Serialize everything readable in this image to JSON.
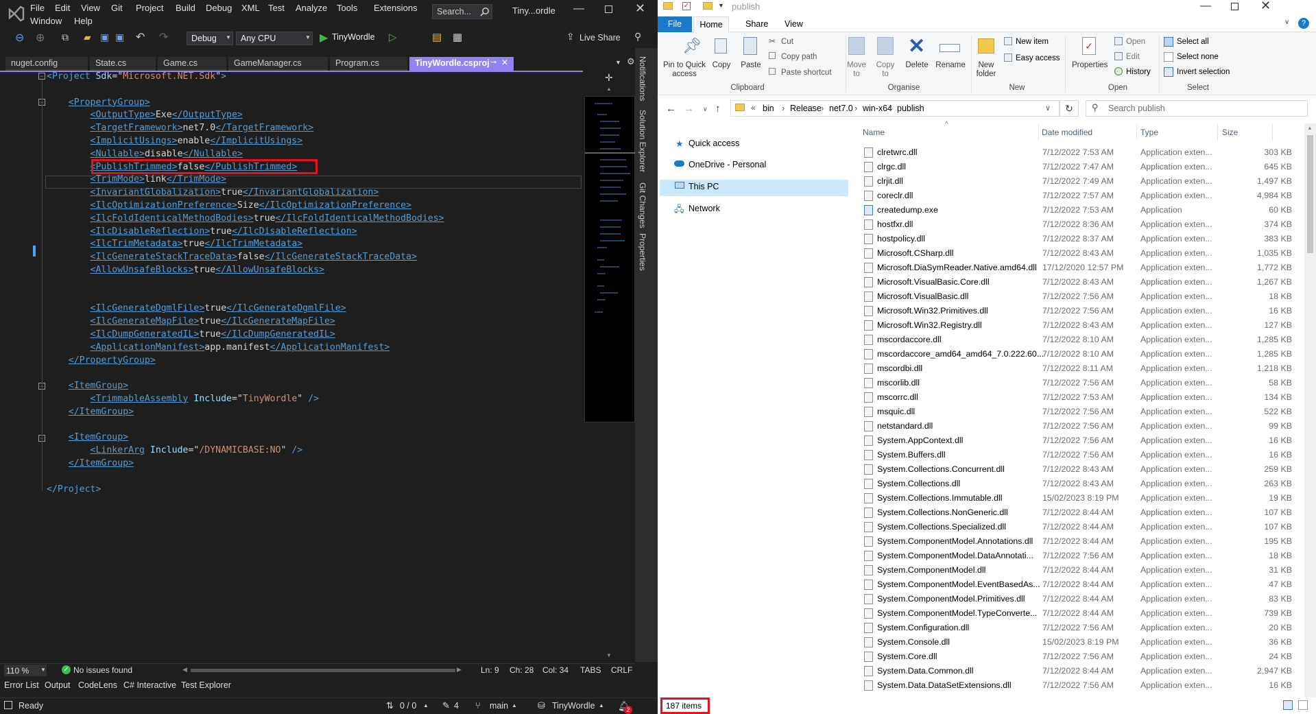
{
  "vs": {
    "menu": [
      "File",
      "Edit",
      "View",
      "Git",
      "Project",
      "Build",
      "Debug",
      "XML",
      "Test",
      "Analyze",
      "Tools",
      "Extensions"
    ],
    "menu2": [
      "Window",
      "Help"
    ],
    "search_placeholder": "Search...",
    "solution_title": "Tiny...ordle",
    "config": "Debug",
    "platform": "Any CPU",
    "run_target": "TinyWordle",
    "live_share": "Live Share",
    "tabs": [
      "nuget.config",
      "State.cs",
      "Game.cs",
      "GameManager.cs",
      "Program.cs",
      "TinyWordle.csproj"
    ],
    "side_tabs": [
      "Notifications",
      "Solution Explorer",
      "Git Changes",
      "Properties"
    ],
    "code": [
      [
        [
          "t",
          "<"
        ],
        [
          "t",
          "Project"
        ],
        [
          "x",
          " "
        ],
        [
          "a",
          "Sdk"
        ],
        [
          "q",
          "=\""
        ],
        [
          "v",
          "Microsoft.NET.Sdk"
        ],
        [
          "q",
          "\""
        ],
        [
          "t",
          ">"
        ]
      ],
      [],
      [
        [
          "x",
          "    "
        ],
        [
          "t",
          "<PropertyGroup>"
        ]
      ],
      [
        [
          "x",
          "        "
        ],
        [
          "t",
          "<OutputType>"
        ],
        [
          "x",
          "Exe"
        ],
        [
          "t",
          "</OutputType>"
        ]
      ],
      [
        [
          "x",
          "        "
        ],
        [
          "t",
          "<TargetFramework>"
        ],
        [
          "x",
          "net7.0"
        ],
        [
          "t",
          "</TargetFramework>"
        ]
      ],
      [
        [
          "x",
          "        "
        ],
        [
          "t",
          "<ImplicitUsings>"
        ],
        [
          "x",
          "enable"
        ],
        [
          "t",
          "</ImplicitUsings>"
        ]
      ],
      [
        [
          "x",
          "        "
        ],
        [
          "t",
          "<Nullable>"
        ],
        [
          "x",
          "disable"
        ],
        [
          "t",
          "</Nullable>"
        ]
      ],
      [
        [
          "x",
          "        "
        ],
        [
          "t",
          "<PublishTrimmed>"
        ],
        [
          "x",
          "false"
        ],
        [
          "t",
          "</PublishTrimmed>"
        ]
      ],
      [
        [
          "x",
          "        "
        ],
        [
          "t",
          "<TrimMode>"
        ],
        [
          "x",
          "link"
        ],
        [
          "t",
          "</TrimMode>"
        ]
      ],
      [
        [
          "x",
          "        "
        ],
        [
          "t",
          "<InvariantGlobalization>"
        ],
        [
          "x",
          "true"
        ],
        [
          "t",
          "</InvariantGlobalization>"
        ]
      ],
      [
        [
          "x",
          "        "
        ],
        [
          "t",
          "<IlcOptimizationPreference>"
        ],
        [
          "x",
          "Size"
        ],
        [
          "t",
          "</IlcOptimizationPreference>"
        ]
      ],
      [
        [
          "x",
          "        "
        ],
        [
          "t",
          "<IlcFoldIdenticalMethodBodies>"
        ],
        [
          "x",
          "true"
        ],
        [
          "t",
          "</IlcFoldIdenticalMethodBodies>"
        ]
      ],
      [
        [
          "x",
          "        "
        ],
        [
          "t",
          "<IlcDisableReflection>"
        ],
        [
          "x",
          "true"
        ],
        [
          "t",
          "</IlcDisableReflection>"
        ]
      ],
      [
        [
          "x",
          "        "
        ],
        [
          "t",
          "<IlcTrimMetadata>"
        ],
        [
          "x",
          "true"
        ],
        [
          "t",
          "</IlcTrimMetadata>"
        ]
      ],
      [
        [
          "x",
          "        "
        ],
        [
          "t",
          "<IlcGenerateStackTraceData>"
        ],
        [
          "x",
          "false"
        ],
        [
          "t",
          "</IlcGenerateStackTraceData>"
        ]
      ],
      [
        [
          "x",
          "        "
        ],
        [
          "t",
          "<AllowUnsafeBlocks>"
        ],
        [
          "x",
          "true"
        ],
        [
          "t",
          "</AllowUnsafeBlocks>"
        ]
      ],
      [],
      [],
      [
        [
          "x",
          "        "
        ],
        [
          "t",
          "<IlcGenerateDgmlFile>"
        ],
        [
          "x",
          "true"
        ],
        [
          "t",
          "</IlcGenerateDgmlFile>"
        ]
      ],
      [
        [
          "x",
          "        "
        ],
        [
          "t",
          "<IlcGenerateMapFile>"
        ],
        [
          "x",
          "true"
        ],
        [
          "t",
          "</IlcGenerateMapFile>"
        ]
      ],
      [
        [
          "x",
          "        "
        ],
        [
          "t",
          "<IlcDumpGeneratedIL>"
        ],
        [
          "x",
          "true"
        ],
        [
          "t",
          "</IlcDumpGeneratedIL>"
        ]
      ],
      [
        [
          "x",
          "        "
        ],
        [
          "t",
          "<ApplicationManifest>"
        ],
        [
          "x",
          "app.manifest"
        ],
        [
          "t",
          "</ApplicationManifest>"
        ]
      ],
      [
        [
          "x",
          "    "
        ],
        [
          "t",
          "</PropertyGroup>"
        ]
      ],
      [],
      [
        [
          "x",
          "    "
        ],
        [
          "t",
          "<ItemGroup>"
        ]
      ],
      [
        [
          "x",
          "        "
        ],
        [
          "t",
          "<TrimmableAssembly"
        ],
        [
          "x",
          " "
        ],
        [
          "a",
          "Include"
        ],
        [
          "q",
          "=\""
        ],
        [
          "v",
          "TinyWordle"
        ],
        [
          "q",
          "\""
        ],
        [
          "x",
          " "
        ],
        [
          "t",
          "/>"
        ]
      ],
      [
        [
          "x",
          "    "
        ],
        [
          "t",
          "</ItemGroup>"
        ]
      ],
      [],
      [
        [
          "x",
          "    "
        ],
        [
          "t",
          "<ItemGroup>"
        ]
      ],
      [
        [
          "x",
          "        "
        ],
        [
          "t",
          "<LinkerArg"
        ],
        [
          "x",
          " "
        ],
        [
          "a",
          "Include"
        ],
        [
          "q",
          "=\""
        ],
        [
          "v",
          "/DYNAMICBASE:NO"
        ],
        [
          "q",
          "\""
        ],
        [
          "x",
          " "
        ],
        [
          "t",
          "/>"
        ]
      ],
      [
        [
          "x",
          "    "
        ],
        [
          "t",
          "</ItemGroup>"
        ]
      ],
      [],
      [
        [
          "t",
          "</Project>"
        ]
      ]
    ],
    "zoom": "110 %",
    "issues": "No issues found",
    "ln": "Ln: 9",
    "ch": "Ch: 28",
    "col": "Col: 34",
    "tabs_mode": "TABS",
    "eol": "CRLF",
    "bottom_tabs": [
      "Error List",
      "Output",
      "CodeLens",
      "C# Interactive",
      "Test Explorer"
    ],
    "status": "Ready",
    "git_counts": "0 / 0",
    "pencil_count": "4",
    "branch": "main",
    "repo": "TinyWordle",
    "notif_count": "2"
  },
  "fe": {
    "title": "publish",
    "ribbon_tabs": [
      "File",
      "Home",
      "Share",
      "View"
    ],
    "clipboard": {
      "pin": "Pin to Quick access",
      "copy": "Copy",
      "paste": "Paste",
      "cut": "Cut",
      "copy_path": "Copy path",
      "paste_shortcut": "Paste shortcut",
      "label": "Clipboard"
    },
    "organise": {
      "move": "Move to",
      "copy": "Copy to",
      "delete": "Delete",
      "rename": "Rename",
      "label": "Organise"
    },
    "new": {
      "folder": "New folder",
      "new_item": "New item",
      "easy_access": "Easy access",
      "label": "New"
    },
    "open": {
      "properties": "Properties",
      "open": "Open",
      "edit": "Edit",
      "history": "History",
      "label": "Open"
    },
    "select": {
      "all": "Select all",
      "none": "Select none",
      "invert": "Invert selection",
      "label": "Select"
    },
    "breadcrumb": [
      "bin",
      "Release",
      "net7.0",
      "win-x64",
      "publish"
    ],
    "search_placeholder": "Search publish",
    "nav": [
      "Quick access",
      "OneDrive - Personal",
      "This PC",
      "Network"
    ],
    "headers": {
      "name": "Name",
      "date": "Date modified",
      "type": "Type",
      "size": "Size"
    },
    "files": [
      [
        "clretwrc.dll",
        "7/12/2022 7:53 AM",
        "Application exten...",
        "303 KB"
      ],
      [
        "clrgc.dll",
        "7/12/2022 7:47 AM",
        "Application exten...",
        "645 KB"
      ],
      [
        "clrjit.dll",
        "7/12/2022 7:49 AM",
        "Application exten...",
        "1,497 KB"
      ],
      [
        "coreclr.dll",
        "7/12/2022 7:57 AM",
        "Application exten...",
        "4,984 KB"
      ],
      [
        "createdump.exe",
        "7/12/2022 7:53 AM",
        "Application",
        "60 KB"
      ],
      [
        "hostfxr.dll",
        "7/12/2022 8:36 AM",
        "Application exten...",
        "374 KB"
      ],
      [
        "hostpolicy.dll",
        "7/12/2022 8:37 AM",
        "Application exten...",
        "383 KB"
      ],
      [
        "Microsoft.CSharp.dll",
        "7/12/2022 8:43 AM",
        "Application exten...",
        "1,035 KB"
      ],
      [
        "Microsoft.DiaSymReader.Native.amd64.dll",
        "17/12/2020 12:57 PM",
        "Application exten...",
        "1,772 KB"
      ],
      [
        "Microsoft.VisualBasic.Core.dll",
        "7/12/2022 8:43 AM",
        "Application exten...",
        "1,267 KB"
      ],
      [
        "Microsoft.VisualBasic.dll",
        "7/12/2022 7:56 AM",
        "Application exten...",
        "18 KB"
      ],
      [
        "Microsoft.Win32.Primitives.dll",
        "7/12/2022 7:56 AM",
        "Application exten...",
        "16 KB"
      ],
      [
        "Microsoft.Win32.Registry.dll",
        "7/12/2022 8:43 AM",
        "Application exten...",
        "127 KB"
      ],
      [
        "mscordaccore.dll",
        "7/12/2022 8:10 AM",
        "Application exten...",
        "1,285 KB"
      ],
      [
        "mscordaccore_amd64_amd64_7.0.222.60...",
        "7/12/2022 8:10 AM",
        "Application exten...",
        "1,285 KB"
      ],
      [
        "mscordbi.dll",
        "7/12/2022 8:11 AM",
        "Application exten...",
        "1,218 KB"
      ],
      [
        "mscorlib.dll",
        "7/12/2022 7:56 AM",
        "Application exten...",
        "58 KB"
      ],
      [
        "mscorrc.dll",
        "7/12/2022 7:53 AM",
        "Application exten...",
        "134 KB"
      ],
      [
        "msquic.dll",
        "7/12/2022 7:56 AM",
        "Application exten...",
        "522 KB"
      ],
      [
        "netstandard.dll",
        "7/12/2022 7:56 AM",
        "Application exten...",
        "99 KB"
      ],
      [
        "System.AppContext.dll",
        "7/12/2022 7:56 AM",
        "Application exten...",
        "16 KB"
      ],
      [
        "System.Buffers.dll",
        "7/12/2022 7:56 AM",
        "Application exten...",
        "16 KB"
      ],
      [
        "System.Collections.Concurrent.dll",
        "7/12/2022 8:43 AM",
        "Application exten...",
        "259 KB"
      ],
      [
        "System.Collections.dll",
        "7/12/2022 8:43 AM",
        "Application exten...",
        "263 KB"
      ],
      [
        "System.Collections.Immutable.dll",
        "15/02/2023 8:19 PM",
        "Application exten...",
        "19 KB"
      ],
      [
        "System.Collections.NonGeneric.dll",
        "7/12/2022 8:44 AM",
        "Application exten...",
        "107 KB"
      ],
      [
        "System.Collections.Specialized.dll",
        "7/12/2022 8:44 AM",
        "Application exten...",
        "107 KB"
      ],
      [
        "System.ComponentModel.Annotations.dll",
        "7/12/2022 8:44 AM",
        "Application exten...",
        "195 KB"
      ],
      [
        "System.ComponentModel.DataAnnotati...",
        "7/12/2022 7:56 AM",
        "Application exten...",
        "18 KB"
      ],
      [
        "System.ComponentModel.dll",
        "7/12/2022 8:44 AM",
        "Application exten...",
        "31 KB"
      ],
      [
        "System.ComponentModel.EventBasedAs...",
        "7/12/2022 8:44 AM",
        "Application exten...",
        "47 KB"
      ],
      [
        "System.ComponentModel.Primitives.dll",
        "7/12/2022 8:44 AM",
        "Application exten...",
        "83 KB"
      ],
      [
        "System.ComponentModel.TypeConverte...",
        "7/12/2022 8:44 AM",
        "Application exten...",
        "739 KB"
      ],
      [
        "System.Configuration.dll",
        "7/12/2022 7:56 AM",
        "Application exten...",
        "20 KB"
      ],
      [
        "System.Console.dll",
        "15/02/2023 8:19 PM",
        "Application exten...",
        "36 KB"
      ],
      [
        "System.Core.dll",
        "7/12/2022 7:56 AM",
        "Application exten...",
        "24 KB"
      ],
      [
        "System.Data.Common.dll",
        "7/12/2022 8:44 AM",
        "Application exten...",
        "2,947 KB"
      ],
      [
        "System.Data.DataSetExtensions.dll",
        "7/12/2022 7:56 AM",
        "Application exten...",
        "16 KB"
      ]
    ],
    "item_count": "187 items"
  },
  "colors": {
    "highlight": "#e81123",
    "vs_accent": "#9184ee",
    "fe_accent": "#1979ca"
  }
}
